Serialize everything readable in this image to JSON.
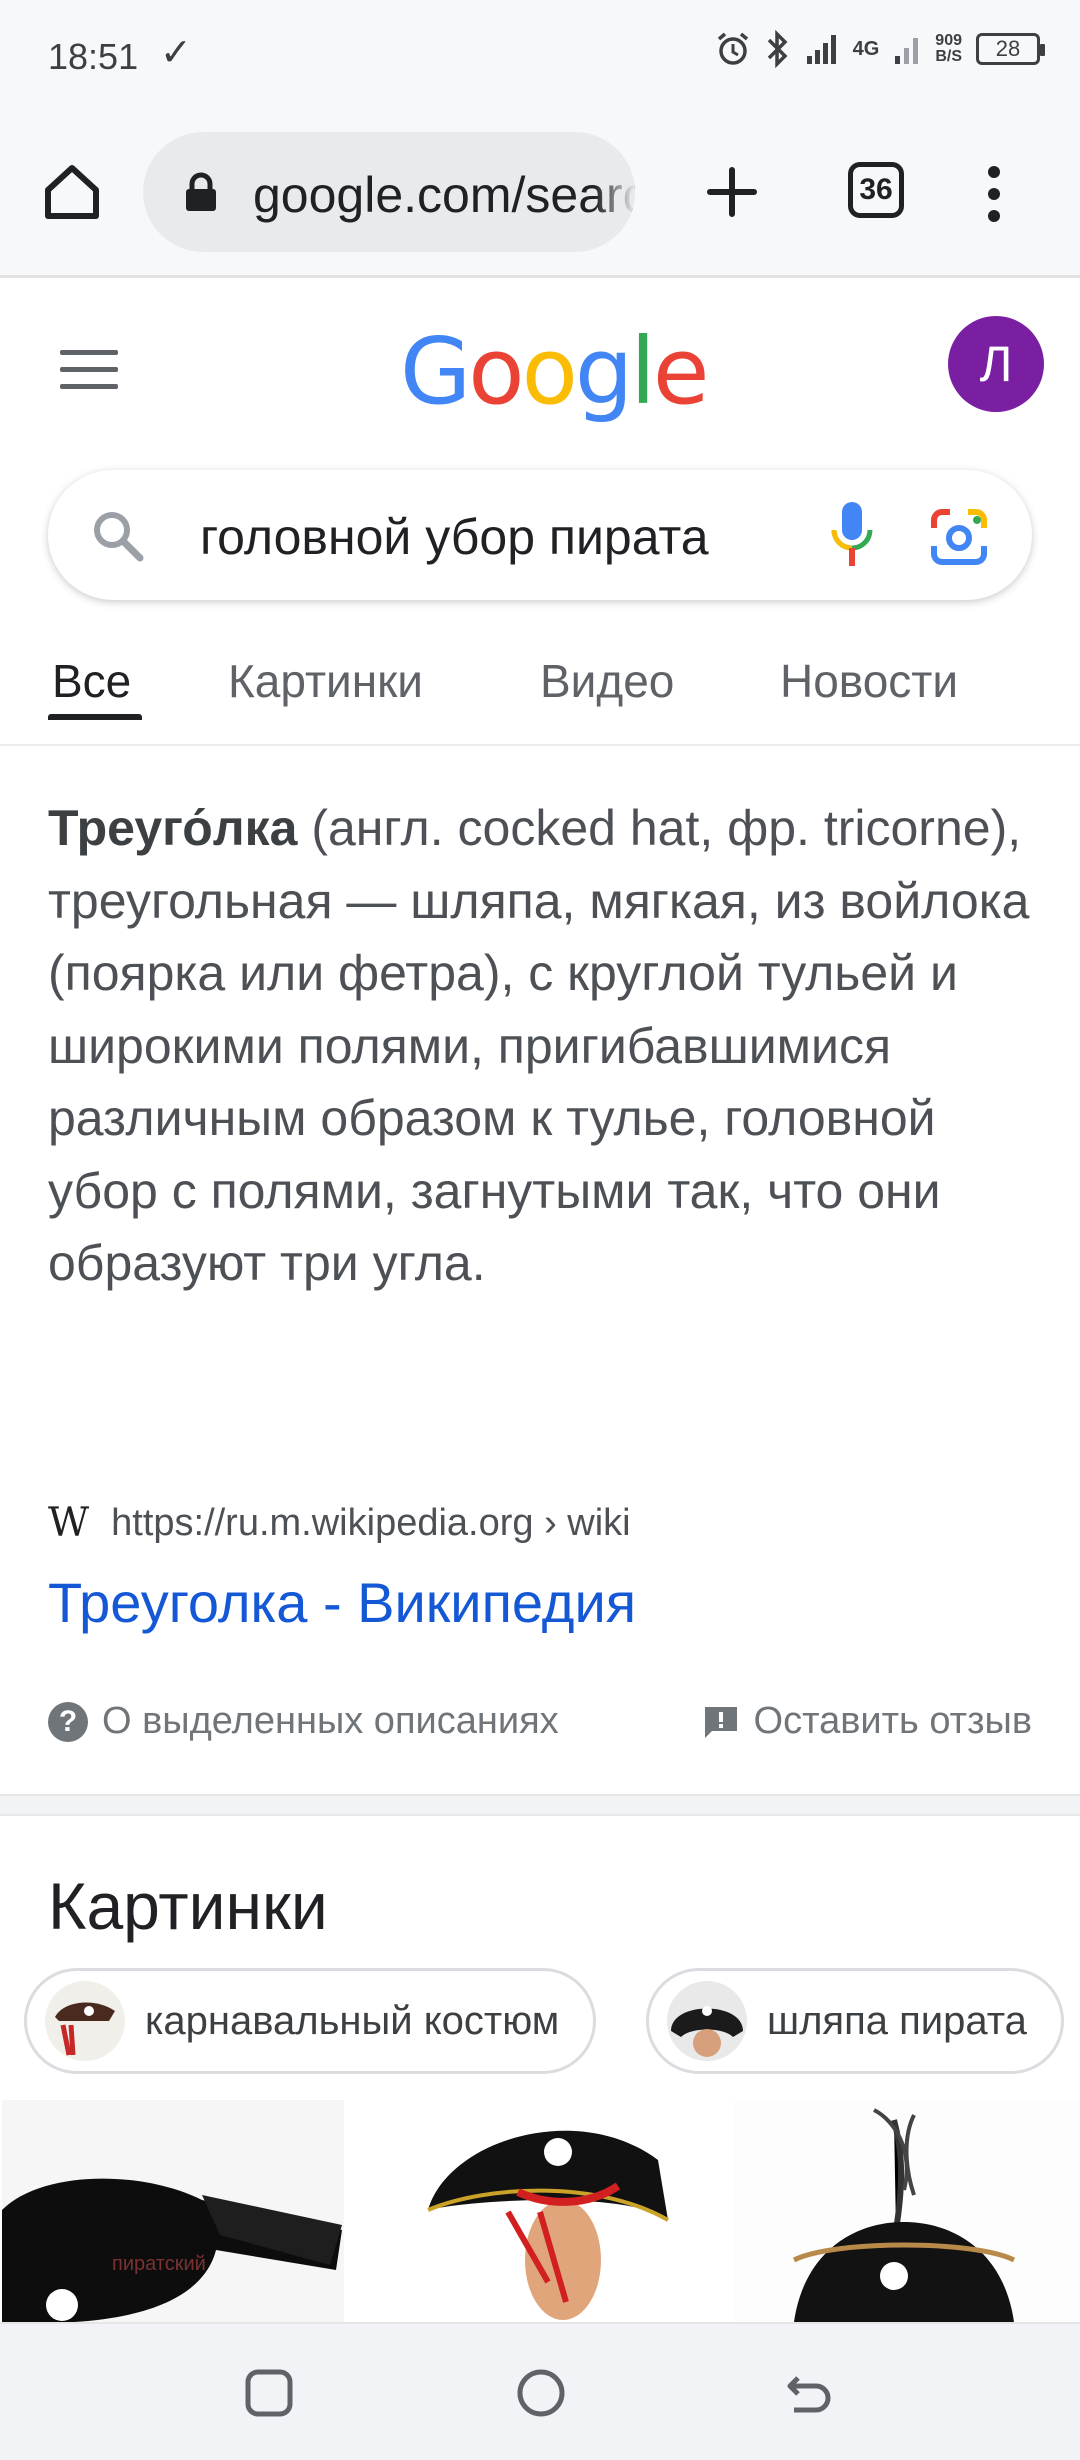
{
  "status_bar": {
    "time": "18:51",
    "network": "4G",
    "net_speed_value": "909",
    "net_speed_unit": "B/S",
    "battery": "28"
  },
  "browser": {
    "url": "google.com/search?q",
    "tab_count": "36"
  },
  "google": {
    "logo_letters": [
      "G",
      "o",
      "o",
      "g",
      "l",
      "e"
    ],
    "logo_colors": [
      "#4285F4",
      "#EA4335",
      "#FBBC05",
      "#4285F4",
      "#34A853",
      "#EA4335"
    ],
    "avatar_letter": "Л",
    "avatar_color": "#7b1fa2"
  },
  "search": {
    "query": "головной убор пирата"
  },
  "tabs": [
    {
      "label": "Все",
      "active": true
    },
    {
      "label": "Картинки",
      "active": false
    },
    {
      "label": "Видео",
      "active": false
    },
    {
      "label": "Новости",
      "active": false
    }
  ],
  "featured_snippet": {
    "term": "Треуго́лка",
    "text": " (англ. cocked hat, фр. tricorne), треугольная — шляпа, мягкая, из войлока (поярка или фетра), с круглой тульей и широкими полями, пригибавшимися различным образом к тулье, головной убор с полями, загнутыми так, что они образуют три угла.",
    "source_icon": "W",
    "source_url": "https://ru.m.wikipedia.org › wiki",
    "title": "Треуголка - Википедия",
    "about_label": "О выделенных описаниях",
    "feedback_label": "Оставить отзыв"
  },
  "images_section": {
    "heading": "Картинки",
    "chips": [
      {
        "label": "карнавальный костюм"
      },
      {
        "label": "шляпа пирата"
      }
    ]
  },
  "colors": {
    "link": "#1558d6",
    "active_tab": "#202124"
  }
}
